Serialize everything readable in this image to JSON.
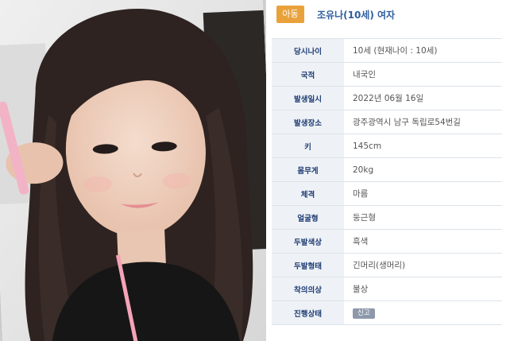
{
  "header": {
    "category": "아동",
    "title": "조유나(10세) 여자"
  },
  "details": [
    {
      "label": "당시나이",
      "value": "10세 (현재나이 : 10세)"
    },
    {
      "label": "국적",
      "value": "내국인"
    },
    {
      "label": "발생일시",
      "value": "2022년 06월 16일"
    },
    {
      "label": "발생장소",
      "value": "광주광역시 남구 독립로54번길"
    },
    {
      "label": "키",
      "value": "145cm"
    },
    {
      "label": "몸무게",
      "value": "20kg"
    },
    {
      "label": "체격",
      "value": "마름"
    },
    {
      "label": "얼굴형",
      "value": "둥근형"
    },
    {
      "label": "두발색상",
      "value": "흑색"
    },
    {
      "label": "두발형태",
      "value": "긴머리(생머리)"
    },
    {
      "label": "착의의상",
      "value": "불상"
    },
    {
      "label": "진행상태",
      "value": "신고"
    }
  ],
  "colors": {
    "badge": "#e9a23b",
    "title": "#2f5f9e",
    "label_bg": "#eef2f7",
    "label_text": "#1f3c73",
    "status_badge": "#8d99ab"
  }
}
